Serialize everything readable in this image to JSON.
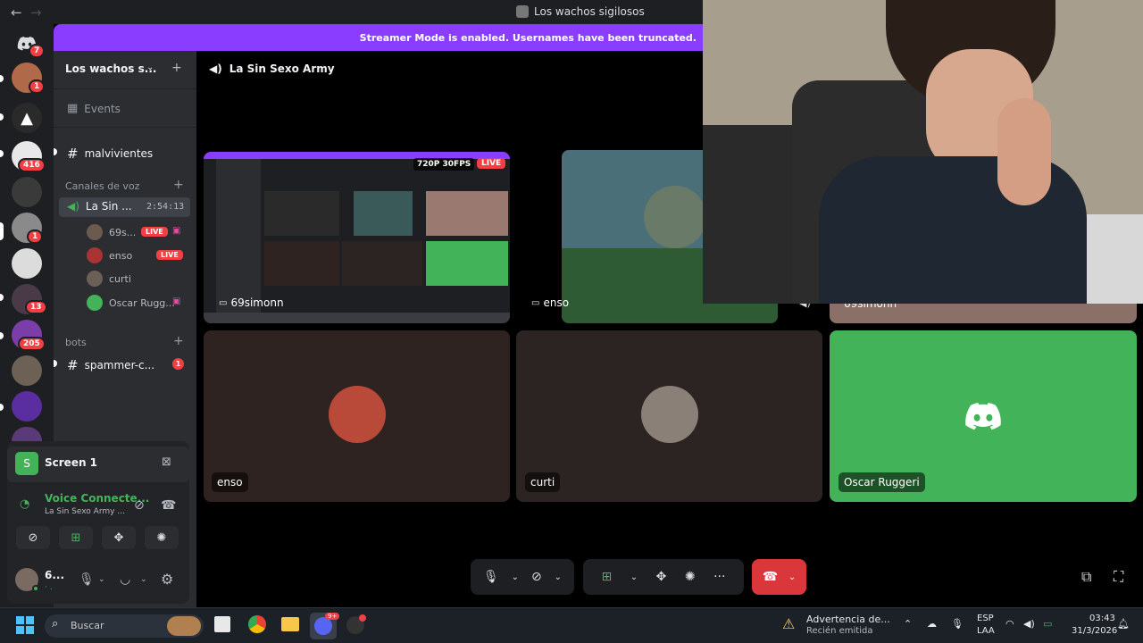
{
  "window": {
    "title": "Los wachos sigilosos",
    "back_icon": "←",
    "forward_icon": "→"
  },
  "banner": {
    "text": "Streamer Mode is enabled. Usernames have been truncated."
  },
  "rail": {
    "badges": [
      "7",
      "1",
      "416",
      "1",
      "13",
      "205"
    ]
  },
  "sidebar": {
    "guild_name": "Los wachos s...",
    "events_label": "Events",
    "channel_malvivientes": "malvivientes",
    "category_voice": "Canales de voz",
    "voice_channel": {
      "name": "La Sin ...",
      "timer": "2:54:13"
    },
    "voice_users": [
      {
        "name": "69s...",
        "live": "LIVE"
      },
      {
        "name": "enso",
        "live": "LIVE"
      },
      {
        "name": "curti",
        "live": ""
      },
      {
        "name": "Oscar Rugg...",
        "live": ""
      }
    ],
    "category_bots": "bots",
    "channel_spammer": "spammer-c...",
    "spammer_badge": "1"
  },
  "panel": {
    "screen_label": "Screen 1",
    "voice_status": "Voice Connecte...",
    "voice_channel_sub": "La Sin Sexo Army ...",
    "user_name": "6...",
    "user_status": "· ."
  },
  "main": {
    "channel_title": "La Sin Sexo Army",
    "stream_quality": "720P 30FPS",
    "stream_live": "LIVE",
    "stream_owner": "69simonn",
    "stream2_owner": "enso",
    "stream3_owner": "69simonn",
    "tiles": [
      {
        "name": "enso",
        "bg": "#2f2321"
      },
      {
        "name": "curti",
        "bg": "#2b2422"
      },
      {
        "name": "Oscar Ruggeri",
        "bg": "#43b35a"
      }
    ]
  },
  "colors": {
    "accent": "#8b3dff",
    "live": "#f23f43",
    "green": "#43b35a",
    "disconnect": "#da373c"
  },
  "taskbar": {
    "search_placeholder": "Buscar",
    "warning_title": "Advertencia de...",
    "warning_sub": "Recién emitida",
    "lang_top": "ESP",
    "lang_bottom": "LAA",
    "time": "03:43",
    "date": "31/3/2026",
    "discord_badge": "9+"
  }
}
